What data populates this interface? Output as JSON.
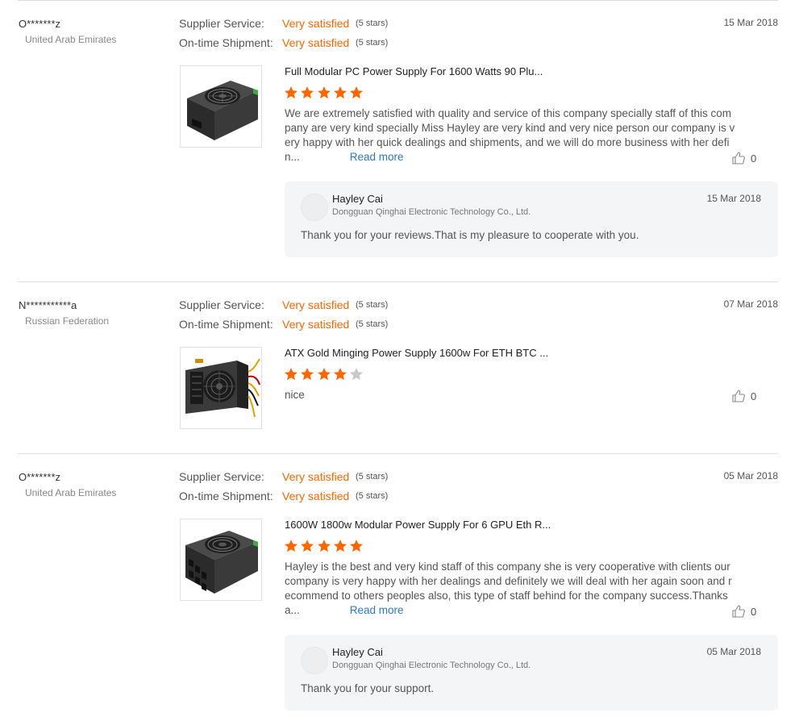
{
  "reviews": [
    {
      "buyer": "O*******z",
      "country": "United Arab Emirates",
      "date": "15 Mar 2018",
      "supplier_service": {
        "label": "Supplier Service:",
        "value": "Very satisfied",
        "stars": "(5 stars)"
      },
      "shipment": {
        "label": "On-time Shipment:",
        "value": "Very satisfied",
        "stars": "(5 stars)"
      },
      "product_title": "Full Modular PC Power Supply For 1600 Watts 90 Plu...",
      "rating": 5,
      "text": "We are extremely satisfied with quality and service of this company specially staff of this company are very kind specially  Miss Hayley are very kind and very nice person our company is very happy with her quick dealings and shipments, and we will do more business with her defin...",
      "read_more": "Read more",
      "likes": "0",
      "reply": {
        "name": "Hayley Cai",
        "company": "Dongguan Qinghai Electronic Technology Co., Ltd.",
        "date": "15 Mar 2018",
        "text": "Thank you for your reviews.That is my pleasure to cooperate with you."
      }
    },
    {
      "buyer": "N***********a",
      "country": "Russian Federation",
      "date": "07 Mar 2018",
      "supplier_service": {
        "label": "Supplier Service:",
        "value": "Very satisfied",
        "stars": "(5 stars)"
      },
      "shipment": {
        "label": "On-time Shipment:",
        "value": "Very satisfied",
        "stars": "(5 stars)"
      },
      "product_title": "ATX Gold Minging Power Supply 1600w For ETH BTC ...",
      "rating": 4,
      "text": "nice",
      "likes": "0"
    },
    {
      "buyer": "O*******z",
      "country": "United Arab Emirates",
      "date": "05 Mar 2018",
      "supplier_service": {
        "label": "Supplier Service:",
        "value": "Very satisfied",
        "stars": "(5 stars)"
      },
      "shipment": {
        "label": "On-time Shipment:",
        "value": "Very satisfied",
        "stars": "(5 stars)"
      },
      "product_title": "1600W 1800w Modular Power Supply For 6 GPU Eth R...",
      "rating": 5,
      "text": "Hayley is the best and very kind staff of this company she is very cooperative with clients our company is very happy with her dealings and definitely we will deal with her again soon and recommend to others peoples also, this type of staff behind for the company success.Thanks a...",
      "read_more": "Read more",
      "likes": "0",
      "reply": {
        "name": "Hayley Cai",
        "company": "Dongguan Qinghai Electronic Technology Co., Ltd.",
        "date": "05 Mar 2018",
        "text": "Thank you for your support."
      }
    }
  ],
  "colors": {
    "accent": "#ff6600",
    "star_on": "#ff6600",
    "star_off": "#c8c8c8",
    "link": "#2a7ac8"
  },
  "icons": {
    "like": "thumbs-up-icon",
    "star": "star-icon"
  }
}
